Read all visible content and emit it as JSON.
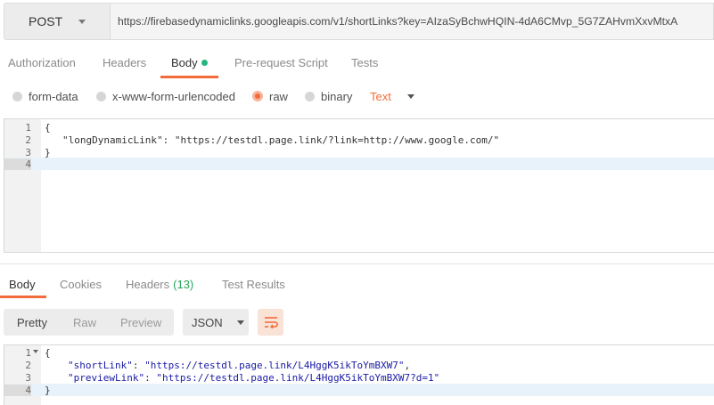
{
  "request": {
    "method": "POST",
    "url": "https://firebasedynamiclinks.googleapis.com/v1/shortLinks?key=AIzaSyBchwHQIN-4dA6CMvp_5G7ZAHvmXxvMtxA"
  },
  "request_tabs": {
    "authorization": "Authorization",
    "headers": "Headers",
    "body": "Body",
    "prerequest": "Pre-request Script",
    "tests": "Tests"
  },
  "body_types": {
    "form_data": "form-data",
    "urlencoded": "x-www-form-urlencoded",
    "raw": "raw",
    "binary": "binary",
    "selected": "raw",
    "content_type": "Text"
  },
  "request_editor": {
    "lines": [
      {
        "num": "1",
        "text": "{"
      },
      {
        "num": "2",
        "key": "\"longDynamicLink\"",
        "sep": ": ",
        "value": "\"https://testdl.page.link/?link=http://www.google.com/\""
      },
      {
        "num": "3",
        "text": "}"
      },
      {
        "num": "4",
        "text": ""
      }
    ],
    "current_line": 4
  },
  "response_tabs": {
    "body": "Body",
    "cookies": "Cookies",
    "headers": "Headers",
    "headers_count": "(13)",
    "test_results": "Test Results"
  },
  "response_view": {
    "pretty": "Pretty",
    "raw": "Raw",
    "preview": "Preview",
    "format": "JSON"
  },
  "response_editor": {
    "lines": [
      {
        "num": "1",
        "text": "{"
      },
      {
        "num": "2",
        "key": "\"shortLink\"",
        "sep": ": ",
        "value": "\"https://testdl.page.link/L4HggK5ikToYmBXW7\"",
        "tail": ","
      },
      {
        "num": "3",
        "key": "\"previewLink\"",
        "sep": ": ",
        "value": "\"https://testdl.page.link/L4HggK5ikToYmBXW7?d=1\""
      },
      {
        "num": "4",
        "text": "}"
      }
    ],
    "current_line": 4
  },
  "colors": {
    "accent": "#f26b3a",
    "dot": "#26b47f",
    "count": "#26a65b",
    "string": "#1a1aa6"
  }
}
